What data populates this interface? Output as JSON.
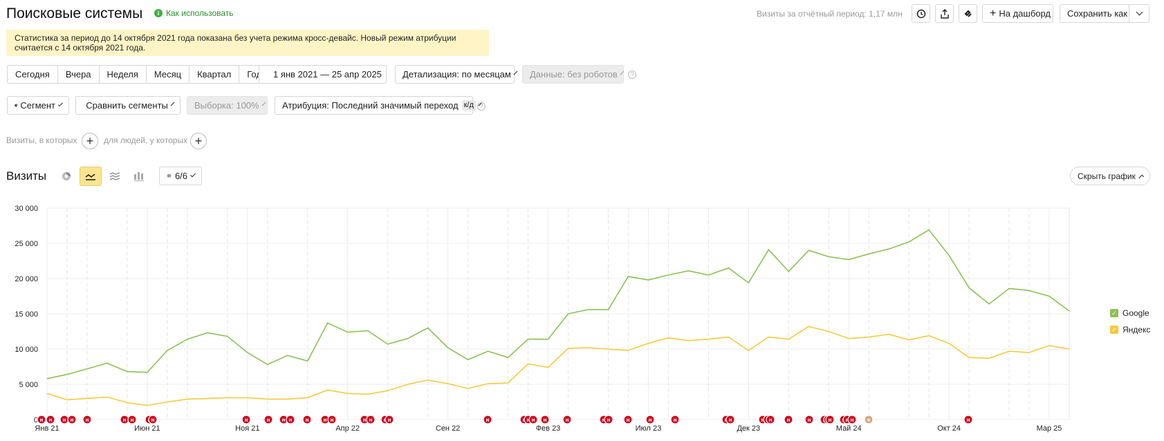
{
  "header": {
    "title": "Поисковые системы",
    "how_to_use": "Как использовать",
    "visits_summary": "Визиты за отчётный период: 1,17 млн",
    "dashboard_label": "На дашборд",
    "save_as_label": "Сохранить как"
  },
  "notice": {
    "line1": "Статистика за период до 14 октября 2021 года показана без учета режима кросс-девайс. Новый режим атрибуции",
    "line2": "считается с 14 октября 2021 года."
  },
  "periods": [
    "Сегодня",
    "Вчера",
    "Неделя",
    "Месяц",
    "Квартал",
    "Год"
  ],
  "date_range": "1 янв 2021 — 25 апр 2025",
  "detail": "Детализация: по месяцам",
  "data_filter": "Данные: без роботов",
  "segment": "Сегмент",
  "compare": "Сравнить сегменты",
  "sample": "Выборка: 100%",
  "attribution": "Атрибуция: Последний значимый переход",
  "attribution_badge": "к/д",
  "filters": {
    "visits_where": "Визиты, в которых",
    "people_where": "для людей, у которых"
  },
  "chart_header": {
    "title": "Визиты",
    "annotations_count": "6/6",
    "hide_chart": "Скрыть график"
  },
  "colors": {
    "google": "#8cc152",
    "yandex": "#f8c93a",
    "marker": "#d0021b",
    "accent": "#fde48e"
  },
  "chart_data": {
    "type": "line",
    "ylim": [
      0,
      30000
    ],
    "y_ticks": [
      "0",
      "5 000",
      "10 000",
      "15 000",
      "20 000",
      "25 000",
      "30 000"
    ],
    "x_tick_labels": [
      {
        "label": "Янв 21",
        "index": 0
      },
      {
        "label": "Июн 21",
        "index": 5
      },
      {
        "label": "Ноя 21",
        "index": 10
      },
      {
        "label": "Апр 22",
        "index": 15
      },
      {
        "label": "Сен 22",
        "index": 20
      },
      {
        "label": "Фев 23",
        "index": 25
      },
      {
        "label": "Июл 23",
        "index": 30
      },
      {
        "label": "Дек 23",
        "index": 35
      },
      {
        "label": "Май 24",
        "index": 40
      },
      {
        "label": "Окт 24",
        "index": 45
      },
      {
        "label": "Мар 25",
        "index": 50
      }
    ],
    "series": [
      {
        "name": "Google",
        "color": "#8cc152",
        "values": [
          5800,
          6400,
          7200,
          8000,
          6800,
          6700,
          9800,
          11400,
          12300,
          11800,
          9500,
          7800,
          9100,
          8300,
          13700,
          12400,
          12600,
          10700,
          11500,
          13000,
          10200,
          8500,
          9700,
          8800,
          11400,
          11400,
          15000,
          15600,
          15600,
          20300,
          19800,
          20500,
          21100,
          20500,
          21500,
          19400,
          24100,
          21000,
          24000,
          23100,
          22700,
          23500,
          24200,
          25200,
          26900,
          23300,
          18700,
          16400,
          18600,
          18300,
          17500,
          15400
        ]
      },
      {
        "name": "Яндекс",
        "color": "#f8c93a",
        "values": [
          3700,
          2800,
          3000,
          3200,
          2400,
          2000,
          2500,
          2900,
          3000,
          3100,
          3100,
          2900,
          2900,
          3100,
          4200,
          3700,
          3600,
          4100,
          5000,
          5600,
          5100,
          4400,
          5100,
          5200,
          7900,
          7400,
          10100,
          10200,
          10000,
          9800,
          10800,
          11600,
          11200,
          11400,
          11700,
          9800,
          11700,
          11400,
          13200,
          12500,
          11500,
          11700,
          12100,
          11300,
          11900,
          10800,
          8800,
          8700,
          9700,
          9500,
          10500,
          10000
        ]
      }
    ],
    "annotation_markers": [
      "н",
      "н",
      "н",
      "н",
      "н",
      "н",
      "н",
      "н",
      "н",
      "н",
      "н",
      "н",
      "н",
      "н",
      "н",
      "н",
      "н",
      "н",
      "н",
      "н",
      "н",
      "н",
      "н",
      "н",
      "н",
      "н",
      "н",
      "н",
      "н",
      "н",
      "н",
      "н",
      "н",
      "н",
      "н",
      "н",
      "н",
      "н",
      "н",
      "н",
      "н",
      "н",
      "н",
      "н",
      "е",
      "н"
    ]
  }
}
